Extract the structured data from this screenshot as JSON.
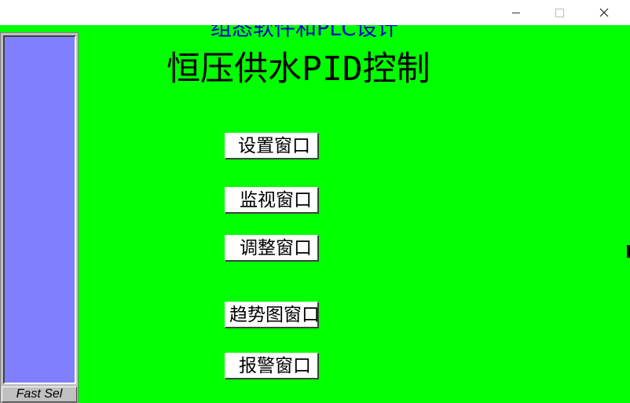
{
  "window": {
    "title": "组态软件和PLC设计",
    "controls": {
      "minimize": "—",
      "maximize": "□",
      "close": "✕"
    }
  },
  "screen": {
    "heading": "恒压供水PID控制"
  },
  "sidebar": {
    "fast_select_label": "Fast Sel"
  },
  "nav_buttons": [
    {
      "label": "设置窗口"
    },
    {
      "label": "监视窗口"
    },
    {
      "label": "调整窗口"
    },
    {
      "label": "趋势图窗口"
    },
    {
      "label": "报警窗口"
    }
  ],
  "colors": {
    "background": "#00ff00",
    "title_text": "#0000cc",
    "sidebar_list": "#8080ff",
    "button_face": "#ffffff"
  }
}
